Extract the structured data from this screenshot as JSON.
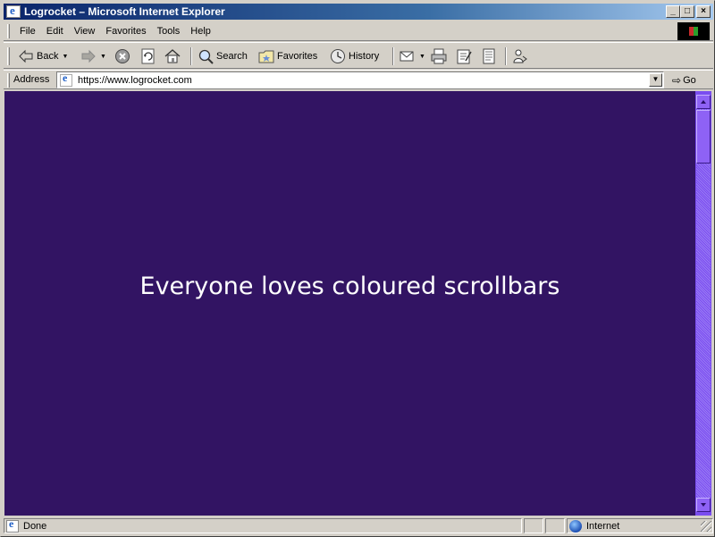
{
  "window": {
    "title": "Logrocket – Microsoft Internet Explorer",
    "controls": {
      "minimize": "_",
      "maximize": "□",
      "close": "×"
    }
  },
  "menu": {
    "items": [
      {
        "label": "File",
        "icon": null
      },
      {
        "label": "Edit"
      },
      {
        "label": "View"
      },
      {
        "label": "Favorites"
      },
      {
        "label": "Tools"
      },
      {
        "label": "Help"
      }
    ]
  },
  "toolbar": {
    "back_label": "Back",
    "search_label": "Search",
    "favorites_label": "Favorites",
    "history_label": "History",
    "icons": [
      "back-arrow-icon",
      "forward-arrow-icon",
      "stop-icon",
      "refresh-icon",
      "home-icon",
      "search-icon",
      "favorites-icon",
      "history-icon",
      "mail-icon",
      "print-icon",
      "edit-icon",
      "discuss-icon",
      "messenger-icon"
    ]
  },
  "address": {
    "label": "Address",
    "url": "https://www.logrocket.com",
    "go_label": "Go"
  },
  "content": {
    "message": "Everyone loves coloured scrollbars",
    "background_color": "#321463",
    "text_color": "#ffffff"
  },
  "scrollbar": {
    "face_color": "#8e62f5",
    "track_color": "#7a4df0"
  },
  "status": {
    "text": "Done",
    "zone": "Internet"
  }
}
